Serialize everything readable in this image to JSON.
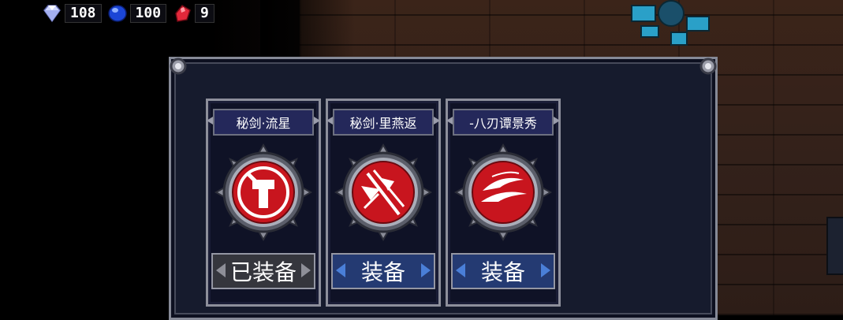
{
  "hud": {
    "diamonds": "108",
    "sapphires": "100",
    "rubies": "9",
    "icons": [
      "diamond-icon",
      "sapphire-icon",
      "ruby-icon"
    ]
  },
  "skills": [
    {
      "name": "秘剑·流星",
      "button": "已装备",
      "state": "equipped",
      "icon": "meteor-skill-icon"
    },
    {
      "name": "秘剑·里燕返",
      "button": "装备",
      "state": "available",
      "icon": "swallow-return-skill-icon"
    },
    {
      "name": "-八刃谭景秀",
      "button": "装备",
      "state": "available",
      "icon": "eight-blade-skill-icon"
    }
  ],
  "colors": {
    "emblem_red": "#c8151e",
    "panel_bg": "#161b2d",
    "button_blue": "#243a72",
    "button_gray": "#35363d"
  }
}
